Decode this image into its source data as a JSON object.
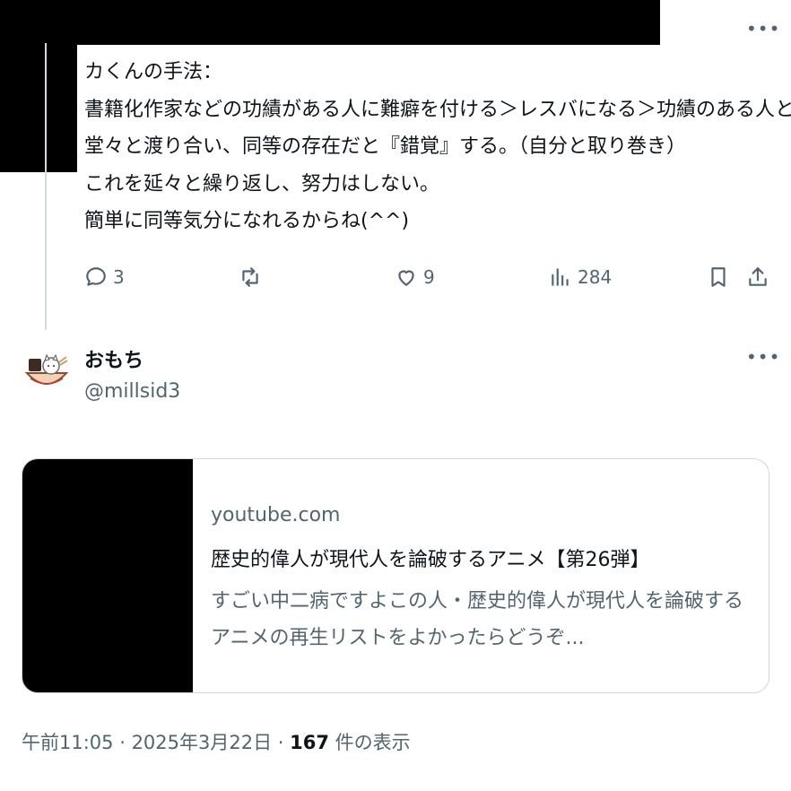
{
  "post": {
    "lines": [
      "カくんの手法：",
      "書籍化作家などの功績がある人に難癖を付ける＞レスバになる＞功績のある人と",
      "堂々と渡り合い、同等の存在だと『錯覚』する。（自分と取り巻き）",
      "これを延々と繰り返し、努力はしない。",
      "簡単に同等気分になれるからね(^^)"
    ],
    "more_label": "•••",
    "actions": {
      "replies": "3",
      "likes": "9",
      "views": "284"
    }
  },
  "reply": {
    "name": "おもち",
    "handle": "@millsid3",
    "more_label": "•••",
    "card": {
      "domain": "youtube.com",
      "title": "歴史的偉人が現代人を論破するアニメ【第26弾】",
      "description": "すごい中二病ですよこの人・歴史的偉人が現代人を論破するアニメの再生リストをよかったらどうぞ..."
    },
    "meta": {
      "time": "午前11:05",
      "sep1": " · ",
      "date": "2025年3月22日",
      "sep2": " · ",
      "views_count": "167",
      "views_label": " 件の表示"
    }
  },
  "icons": [
    "reply-icon",
    "repost-icon",
    "like-icon",
    "views-icon",
    "bookmark-icon",
    "share-icon",
    "more-icon"
  ]
}
